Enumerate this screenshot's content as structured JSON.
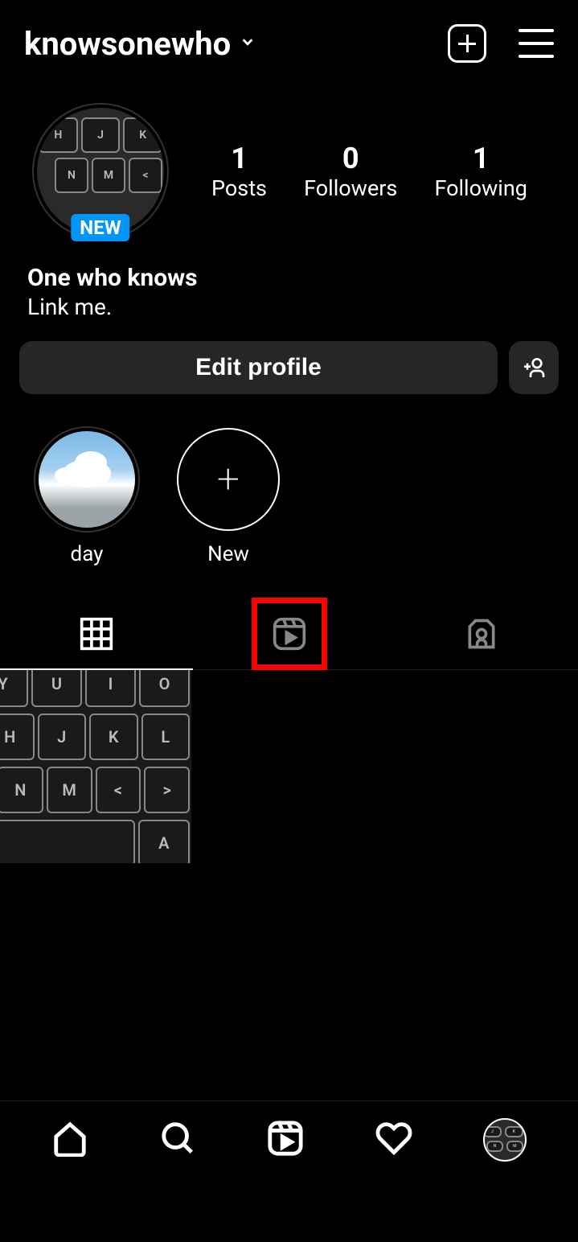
{
  "header": {
    "username": "knowsonewho"
  },
  "avatar": {
    "new_badge": "NEW"
  },
  "stats": {
    "posts_count": "1",
    "posts_label": "Posts",
    "followers_count": "0",
    "followers_label": "Followers",
    "following_count": "1",
    "following_label": "Following"
  },
  "bio": {
    "display_name": "One who knows",
    "text": "Link me."
  },
  "actions": {
    "edit_label": "Edit profile"
  },
  "highlights": {
    "items": [
      {
        "label": "day"
      },
      {
        "label": "New"
      }
    ]
  }
}
